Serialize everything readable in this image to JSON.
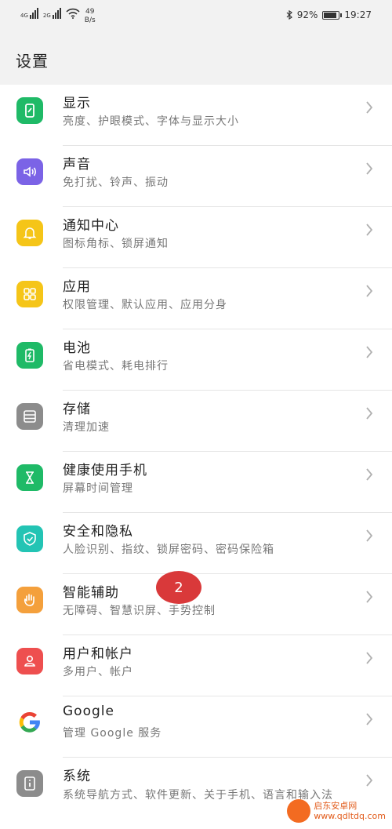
{
  "status": {
    "net1": "4G",
    "net2": "2G",
    "speed_value": "49",
    "speed_unit": "B/s",
    "battery_pct": "92%",
    "time": "19:27"
  },
  "header": {
    "title": "设置"
  },
  "items": [
    {
      "title": "显示",
      "subtitle": "亮度、护眼模式、字体与显示大小",
      "icon": "display-icon",
      "color": "#1fba67"
    },
    {
      "title": "声音",
      "subtitle": "免打扰、铃声、振动",
      "icon": "sound-icon",
      "color": "#7b63e6"
    },
    {
      "title": "通知中心",
      "subtitle": "图标角标、锁屏通知",
      "icon": "bell-icon",
      "color": "#f5c518"
    },
    {
      "title": "应用",
      "subtitle": "权限管理、默认应用、应用分身",
      "icon": "apps-icon",
      "color": "#f5c518"
    },
    {
      "title": "电池",
      "subtitle": "省电模式、耗电排行",
      "icon": "battery-icon",
      "color": "#1fba67"
    },
    {
      "title": "存储",
      "subtitle": "清理加速",
      "icon": "storage-icon",
      "color": "#8c8c8c"
    },
    {
      "title": "健康使用手机",
      "subtitle": "屏幕时间管理",
      "icon": "hourglass-icon",
      "color": "#1fba67"
    },
    {
      "title": "安全和隐私",
      "subtitle": "人脸识别、指纹、锁屏密码、密码保险箱",
      "icon": "shield-icon",
      "color": "#23c4b4"
    },
    {
      "title": "智能辅助",
      "subtitle": "无障碍、智慧识屏、手势控制",
      "icon": "hand-icon",
      "color": "#f4a03c"
    },
    {
      "title": "用户和帐户",
      "subtitle": "多用户、帐户",
      "icon": "user-icon",
      "color": "#ee4f4f"
    },
    {
      "title": "Google",
      "subtitle": "管理 Google 服务",
      "icon": "google-icon",
      "color": "#ffffff"
    },
    {
      "title": "系统",
      "subtitle": "系统导航方式、软件更新、关于手机、语言和输入法",
      "icon": "info-icon",
      "color": "#8c8c8c"
    }
  ],
  "annotation": {
    "step": "2"
  },
  "watermark": {
    "name": "启东安卓网",
    "url": "www.qdltdq.com"
  }
}
